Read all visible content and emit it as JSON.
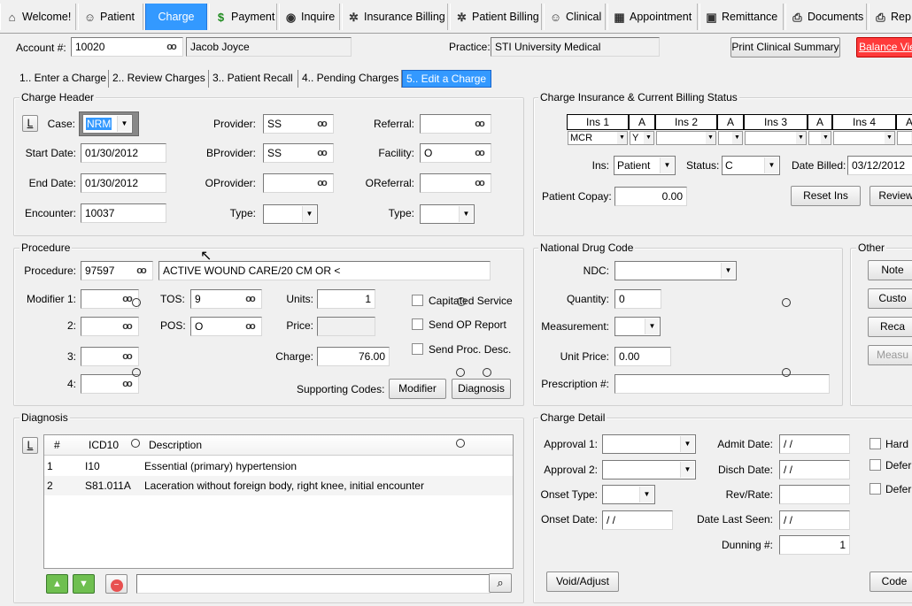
{
  "nav": [
    {
      "label": "Welcome!",
      "icon": "home-icon",
      "glyph": "⌂"
    },
    {
      "label": "Patient",
      "icon": "person-icon",
      "glyph": "☺"
    },
    {
      "label": "Charge",
      "icon": "",
      "glyph": ""
    },
    {
      "label": "Payment",
      "icon": "dollar-icon",
      "glyph": "$"
    },
    {
      "label": "Inquire",
      "icon": "globe-icon",
      "glyph": "◉"
    },
    {
      "label": "Insurance Billing",
      "icon": "gears-icon",
      "glyph": "✲"
    },
    {
      "label": "Patient Billing",
      "icon": "gears-icon",
      "glyph": "✲"
    },
    {
      "label": "Clinical",
      "icon": "doctor-icon",
      "glyph": "☺"
    },
    {
      "label": "Appointment",
      "icon": "calendar-icon",
      "glyph": "▦"
    },
    {
      "label": "Remittance",
      "icon": "monitor-icon",
      "glyph": "▣"
    },
    {
      "label": "Documents",
      "icon": "printer-icon",
      "glyph": "⎙"
    },
    {
      "label": "Rep",
      "icon": "printer-icon",
      "glyph": "⎙"
    }
  ],
  "account": {
    "label": "Account #:",
    "number": "10020",
    "name": "Jacob Joyce",
    "practice_label": "Practice:",
    "practice": "STI University Medical",
    "print_btn": "Print Clinical Summary",
    "balance_btn": "Balance Vie"
  },
  "tabs": [
    "1.. Enter a Charge",
    "2.. Review Charges",
    "3.. Patient Recall",
    "4.. Pending Charges",
    "5.. Edit a Charge"
  ],
  "charge_header": {
    "title": "Charge Header",
    "l_btn": "L",
    "case_label": "Case:",
    "case": "NRM",
    "start_label": "Start Date:",
    "start": "01/30/2012",
    "end_label": "End Date:",
    "end": "01/30/2012",
    "enc_label": "Encounter:",
    "enc": "10037",
    "provider_label": "Provider:",
    "provider": "SS",
    "bprovider_label": "BProvider:",
    "bprovider": "SS",
    "oprovider_label": "OProvider:",
    "oprovider": "",
    "type_label": "Type:",
    "type": "",
    "referral_label": "Referral:",
    "referral": "",
    "facility_label": "Facility:",
    "facility": "O",
    "oreferral_label": "OReferral:",
    "oreferral": "",
    "type2_label": "Type:",
    "type2": ""
  },
  "insurance": {
    "title": "Charge Insurance & Current Billing Status",
    "headers": [
      "Ins 1",
      "A",
      "Ins 2",
      "A",
      "Ins 3",
      "A",
      "Ins 4",
      "A"
    ],
    "row": [
      "MCR",
      "Y",
      "",
      "",
      "",
      "",
      "",
      ""
    ],
    "ins_label": "Ins:",
    "ins": "Patient",
    "status_label": "Status:",
    "status": "C",
    "date_billed_label": "Date Billed:",
    "date_billed": "03/12/2012",
    "copay_label": "Patient Copay:",
    "copay": "0.00",
    "reset_btn": "Reset Ins",
    "review_btn": "Review"
  },
  "procedure": {
    "title": "Procedure",
    "proc_label": "Procedure:",
    "proc": "97597",
    "desc": "ACTIVE WOUND CARE/20 CM OR <",
    "mod1_label": "Modifier 1:",
    "mod2_label": "2:",
    "mod3_label": "3:",
    "mod4_label": "4:",
    "tos_label": "TOS:",
    "tos": "9",
    "pos_label": "POS:",
    "pos": "O",
    "units_label": "Units:",
    "units": "1",
    "price_label": "Price:",
    "price": "",
    "charge_label": "Charge:",
    "charge": "76.00",
    "cap_label": "Capitated Service",
    "opreport_label": "Send OP Report",
    "procdesc_label": "Send Proc. Desc.",
    "supporting_label": "Supporting Codes:",
    "modifier_btn": "Modifier",
    "diagnosis_btn": "Diagnosis"
  },
  "ndc": {
    "title": "National Drug Code",
    "ndc_label": "NDC:",
    "ndc": "",
    "qty_label": "Quantity:",
    "qty": "0",
    "meas_label": "Measurement:",
    "meas": "",
    "unit_price_label": "Unit Price:",
    "unit_price": "0.00",
    "rx_label": "Prescription #:",
    "rx": ""
  },
  "other": {
    "title": "Other",
    "buttons": [
      "Note",
      "Custo",
      "Reca",
      "Measu"
    ]
  },
  "diagnosis": {
    "title": "Diagnosis",
    "l_btn": "L",
    "headers": [
      "#",
      "ICD10",
      "Description"
    ],
    "rows": [
      {
        "num": "1",
        "code": "I10",
        "desc": "Essential (primary) hypertension"
      },
      {
        "num": "2",
        "code": "S81.011A",
        "desc": "Laceration without foreign body, right knee, initial encounter"
      }
    ]
  },
  "detail": {
    "title": "Charge Detail",
    "appr1_label": "Approval 1:",
    "appr2_label": "Approval 2:",
    "onset_type_label": "Onset Type:",
    "onset_date_label": "Onset Date:",
    "onset_date": "/ /",
    "admit_label": "Admit Date:",
    "admit": "/ /",
    "disch_label": "Disch Date:",
    "disch": "/ /",
    "rev_label": "Rev/Rate:",
    "rev": "",
    "last_seen_label": "Date Last Seen:",
    "last_seen": "/ /",
    "dunning_label": "Dunning #:",
    "dunning": "1",
    "hard_label": "Hard C",
    "defer1_label": "Defer",
    "defer2_label": "Defer",
    "void_btn": "Void/Adjust",
    "code_btn": "Code"
  },
  "colors": {
    "accent": "#3399ff",
    "balance_bg": "#ff3a3a",
    "panel": "#f0f0f0"
  }
}
